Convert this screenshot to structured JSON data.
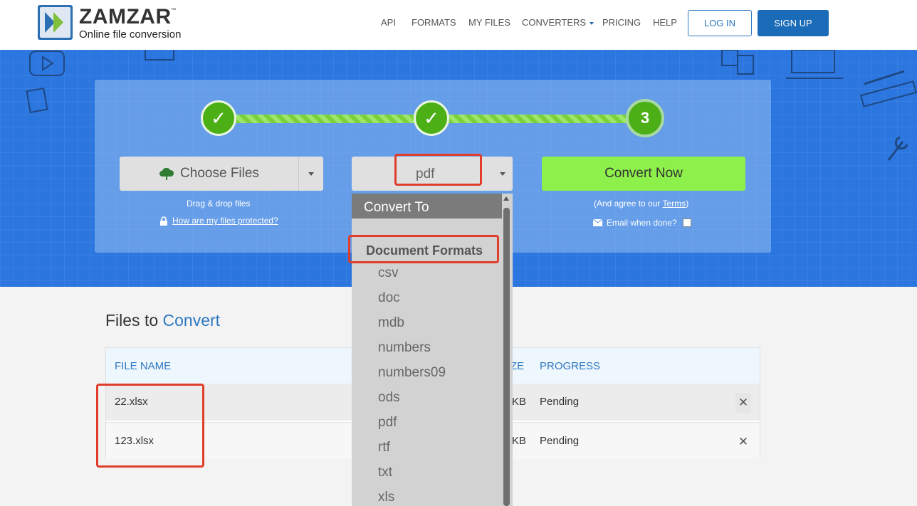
{
  "header": {
    "brand": "ZAMZAR",
    "trademark": "™",
    "tagline": "Online file conversion",
    "nav": {
      "api": "API",
      "formats": "FORMATS",
      "my_files": "MY FILES",
      "converters": "CONVERTERS",
      "pricing": "PRICING",
      "help": "HELP"
    },
    "login": "LOG IN",
    "signup": "SIGN UP"
  },
  "steps": {
    "step1": "✓",
    "step2": "✓",
    "step3": "3"
  },
  "choose": {
    "label": "Choose Files",
    "drag_hint": "Drag & drop files",
    "protect_link": "How are my files protected?"
  },
  "format_select": {
    "value": "pdf"
  },
  "convert": {
    "label": "Convert Now",
    "agree_prefix": "(And agree to our ",
    "terms": "Terms",
    "agree_suffix": ")",
    "email_label": "Email when done?"
  },
  "dropdown": {
    "header": "Convert To",
    "group": "Document Formats",
    "items": [
      "csv",
      "doc",
      "mdb",
      "numbers",
      "numbers09",
      "ods",
      "pdf",
      "rtf",
      "txt",
      "xls"
    ]
  },
  "files": {
    "title_prefix": "Files to",
    "title_accent": "Convert",
    "columns": {
      "name": "FILE NAME",
      "size_partial": "ZE",
      "progress": "PROGRESS"
    },
    "rows": [
      {
        "name": "22.xlsx",
        "size_partial": "KB",
        "progress": "Pending"
      },
      {
        "name": "123.xlsx",
        "size_partial": "KB",
        "progress": "Pending"
      }
    ]
  },
  "colors": {
    "brand_blue": "#1a6bb8",
    "hero_blue": "#2c76e0",
    "step_green": "#4caf16",
    "convert_green": "#8ef04a",
    "highlight_red": "#e03d2c"
  }
}
